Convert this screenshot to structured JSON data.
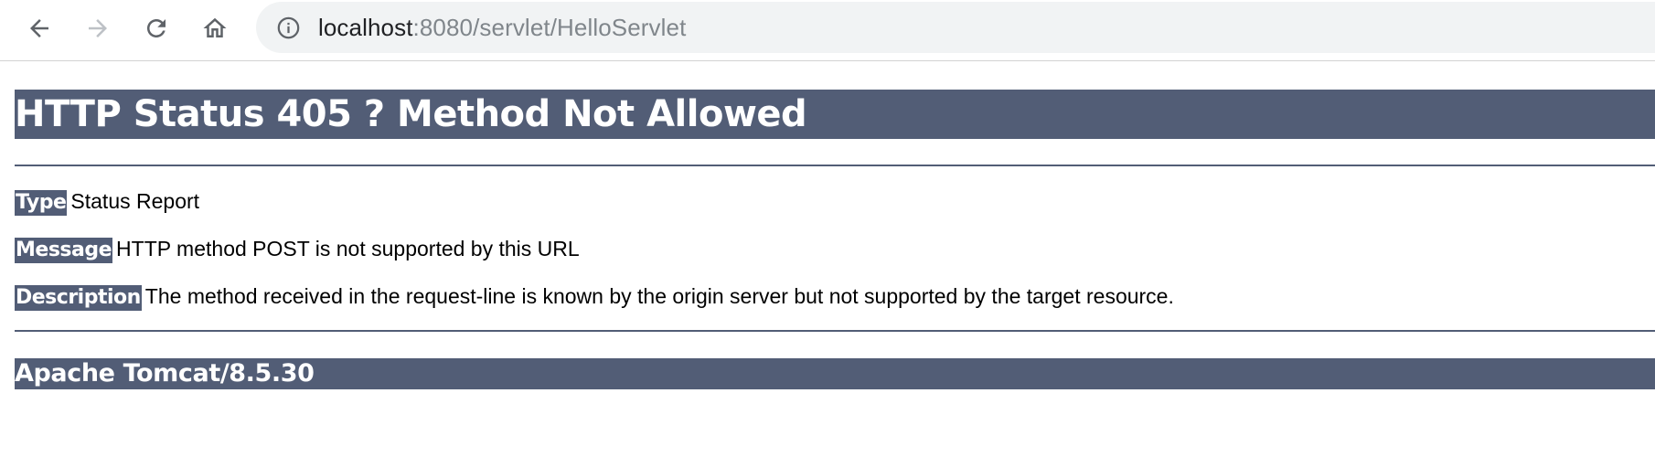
{
  "browser": {
    "url_host": "localhost",
    "url_path": ":8080/servlet/HelloServlet",
    "icons": {
      "back": "arrow-left-icon",
      "forward": "arrow-right-icon",
      "reload": "reload-icon",
      "home": "home-icon",
      "site_info": "info-icon"
    }
  },
  "page": {
    "title": "HTTP Status 405 ? Method Not Allowed",
    "type_label": "Type",
    "type_value": "Status Report",
    "message_label": "Message",
    "message_value": "HTTP method POST is not supported by this URL",
    "description_label": "Description",
    "description_value": "The method received in the request-line is known by the origin server but not supported by the target resource.",
    "footer": "Apache Tomcat/8.5.30"
  },
  "colors": {
    "tomcat_bar": "#525d76",
    "omnibox_bg": "#f1f3f4",
    "url_path": "#80868b"
  }
}
